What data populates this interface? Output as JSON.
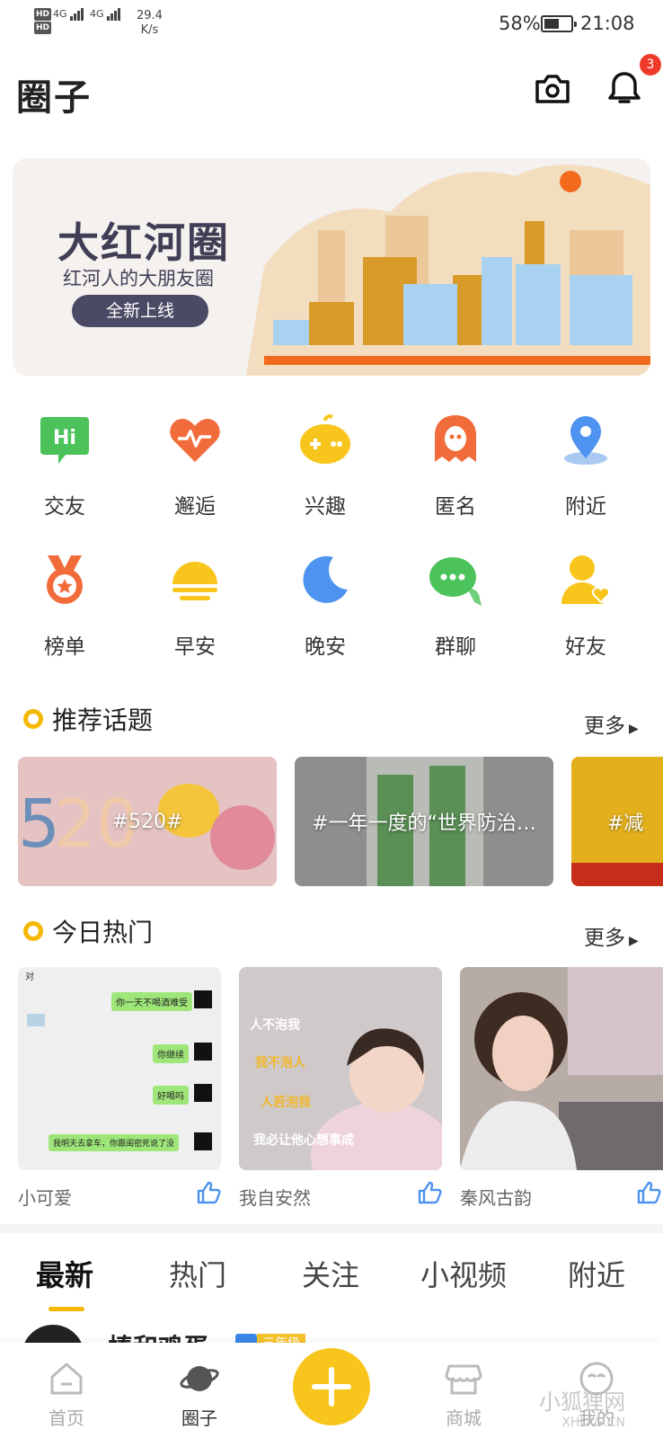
{
  "status_bar": {
    "hd1": "HD",
    "hd2": "HD",
    "net1": "4G",
    "net2": "4G",
    "speed_value": "29.4",
    "speed_unit": "K/s",
    "battery": "58%",
    "battery_level": 0.58,
    "time": "21:08"
  },
  "header": {
    "title": "圈子",
    "notification_count": "3"
  },
  "banner": {
    "title": "大红河圈",
    "subtitle": "红河人的大朋友圈",
    "button": "全新上线"
  },
  "grid": [
    {
      "label": "交友",
      "icon": "hi-chat-icon",
      "color": "#4cc35a"
    },
    {
      "label": "邂逅",
      "icon": "heartbeat-icon",
      "color": "#f26b3a"
    },
    {
      "label": "兴趣",
      "icon": "gamepad-icon",
      "color": "#f7c51b"
    },
    {
      "label": "匿名",
      "icon": "ghost-icon",
      "color": "#f26b3a"
    },
    {
      "label": "附近",
      "icon": "location-pin-icon",
      "color": "#4d93ef"
    },
    {
      "label": "榜单",
      "icon": "medal-icon",
      "color": "#f26b3a"
    },
    {
      "label": "早安",
      "icon": "sunrise-icon",
      "color": "#f7c51b"
    },
    {
      "label": "晚安",
      "icon": "moon-icon",
      "color": "#4d93ef"
    },
    {
      "label": "群聊",
      "icon": "group-chat-icon",
      "color": "#4cc35a"
    },
    {
      "label": "好友",
      "icon": "friend-icon",
      "color": "#f7c51b"
    }
  ],
  "recommended": {
    "title": "推荐话题",
    "more": "更多",
    "topics": [
      {
        "label": "#520#",
        "bg": "#e8c8c8"
      },
      {
        "label": "#一年一度的“世界防治…",
        "bg": "#9a9a98"
      },
      {
        "label": "#减",
        "bg": "#e4b21c"
      }
    ]
  },
  "hot_today": {
    "title": "今日热门",
    "more": "更多",
    "posts": [
      {
        "author": "小可爱"
      },
      {
        "author": "我自安然"
      },
      {
        "author": "秦风古韵"
      }
    ],
    "chat_lines": [
      "对",
      "你一天不喝酒难受",
      "你继续",
      "好喝吗",
      "我明天去拿车，你跟闺密死说了没"
    ],
    "photo_text": [
      "人不泡我",
      "我不泡人",
      "人若泡我",
      "我必让他心想事成"
    ]
  },
  "feed_tabs": [
    "最新",
    "热门",
    "关注",
    "小视频",
    "附近"
  ],
  "feed_preview": {
    "name": "棒和鸡蛋",
    "level": "三年级"
  },
  "bottom_nav": [
    {
      "label": "首页",
      "icon": "home-icon"
    },
    {
      "label": "圈子",
      "icon": "planet-icon"
    },
    {
      "label": "",
      "icon": "plus-icon"
    },
    {
      "label": "商城",
      "icon": "store-icon"
    },
    {
      "label": "我的",
      "icon": "profile-icon"
    }
  ],
  "watermark": {
    "text": "小狐狸网",
    "sub": "XHLKS.CN"
  }
}
